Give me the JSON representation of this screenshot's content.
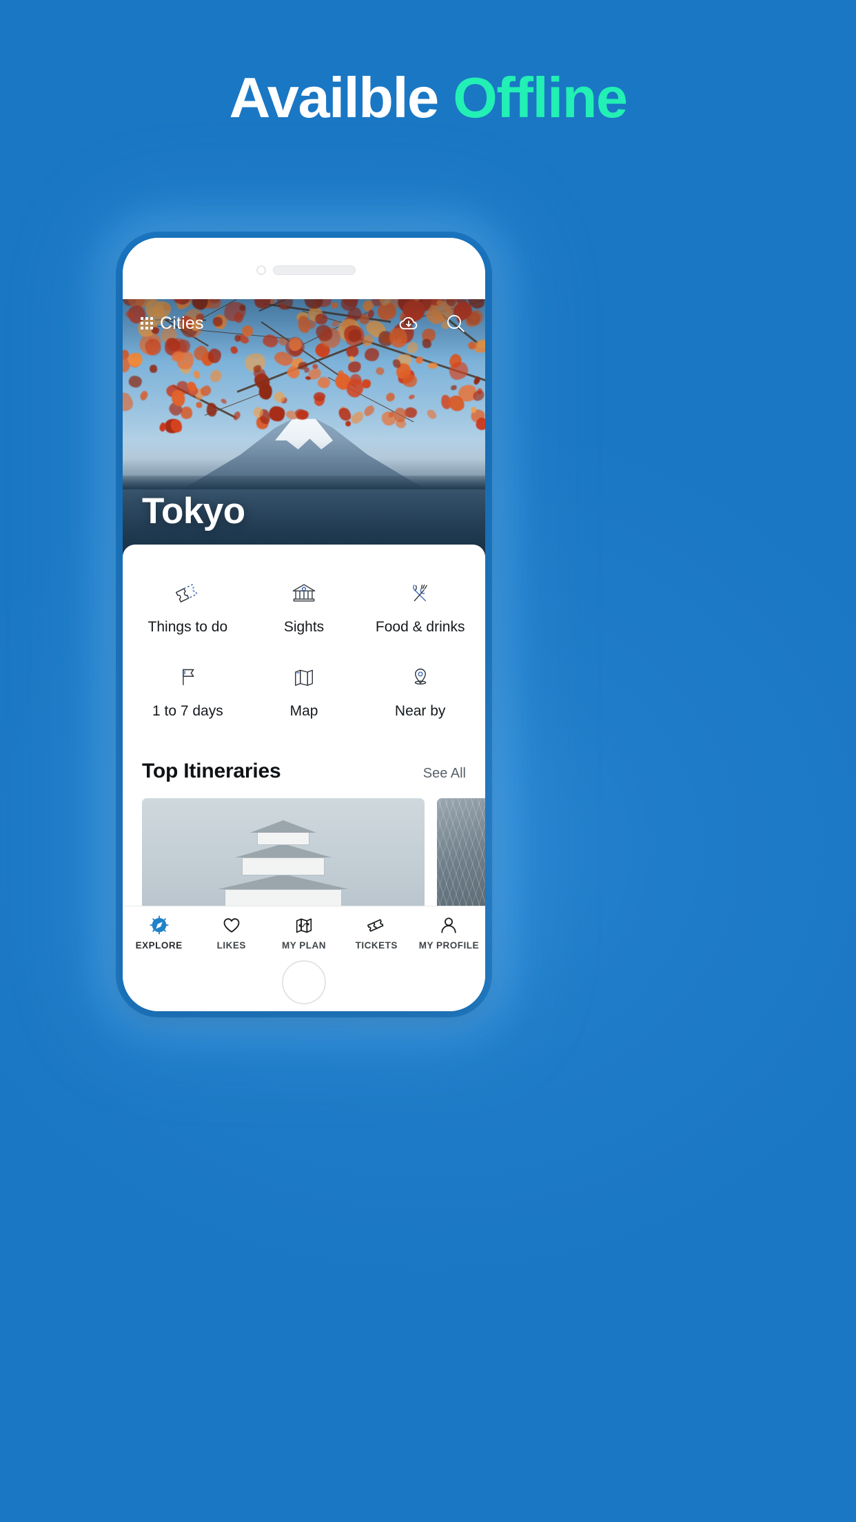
{
  "page": {
    "headline_white": "Availble",
    "headline_accent": " Offline",
    "bg_color": "#1a77c4",
    "accent_color": "#22f0b4"
  },
  "app": {
    "header": {
      "grid_icon": "grid-icon",
      "title": "Cities",
      "download_icon": "cloud-download-icon",
      "search_icon": "search-icon"
    },
    "hero": {
      "city": "Tokyo"
    },
    "categories": [
      {
        "label": "Things to do",
        "icon": "tickets-icon"
      },
      {
        "label": "Sights",
        "icon": "museum-icon"
      },
      {
        "label": "Food & drinks",
        "icon": "fork-knife-icon"
      },
      {
        "label": "1 to 7 days",
        "icon": "flag-icon"
      },
      {
        "label": "Map",
        "icon": "folded-map-icon"
      },
      {
        "label": "Near by",
        "icon": "map-pin-icon"
      }
    ],
    "itineraries": {
      "title": "Top Itineraries",
      "see_all": "See All",
      "cards": [
        {
          "name": "castle-card"
        },
        {
          "name": "tower-card"
        }
      ]
    },
    "bottom_nav": [
      {
        "label": "EXPLORE",
        "icon": "compass-icon",
        "active": true
      },
      {
        "label": "LIKES",
        "icon": "heart-icon",
        "active": false
      },
      {
        "label": "MY PLAN",
        "icon": "route-map-icon",
        "active": false
      },
      {
        "label": "TICKETS",
        "icon": "tickets-icon",
        "active": false
      },
      {
        "label": "MY PROFILE",
        "icon": "person-icon",
        "active": false
      }
    ]
  }
}
